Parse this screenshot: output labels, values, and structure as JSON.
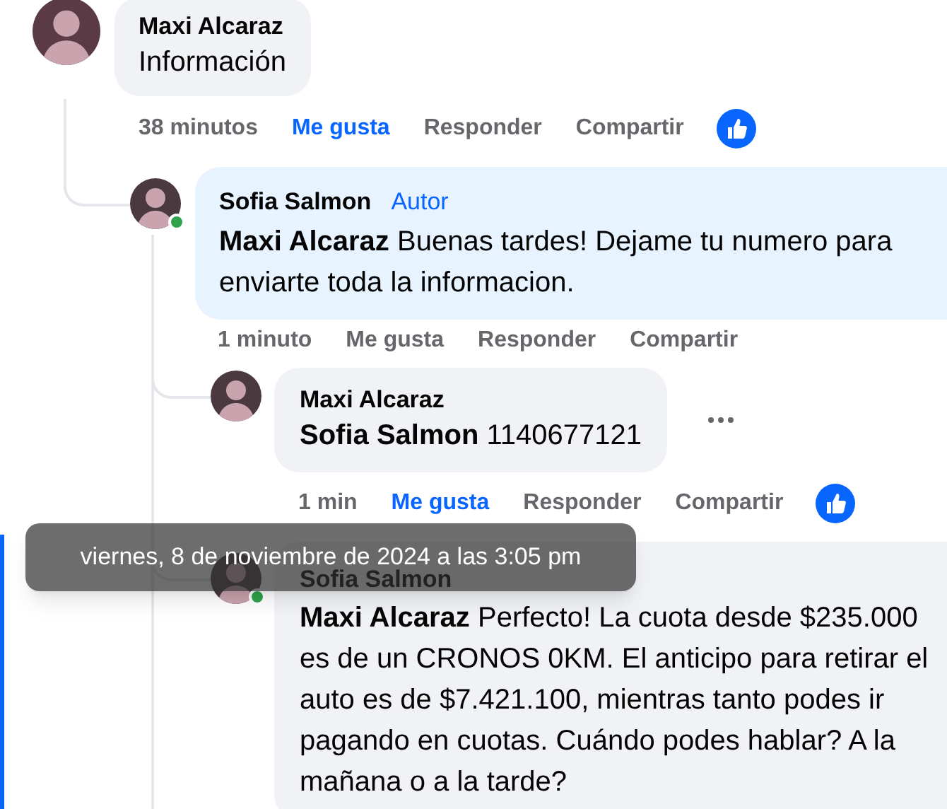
{
  "comments": [
    {
      "author": "Maxi Alcaraz",
      "text": "Información",
      "time": "38 minutos",
      "like_label": "Me gusta",
      "liked": true,
      "reply_label": "Responder",
      "share_label": "Compartir",
      "has_reactions": true,
      "online": false,
      "children": [
        {
          "author": "Sofia Salmon",
          "badge": "Autor",
          "text": "**Maxi Alcaraz** Buenas tardes! Dejame tu numero para enviarte toda la informacion.",
          "time": "1 minuto",
          "like_label": "Me gusta",
          "liked": false,
          "reply_label": "Responder",
          "share_label": "Compartir",
          "online": true,
          "children": [
            {
              "author": "Maxi Alcaraz",
              "text": "**Sofia Salmon** 1140677121",
              "time": "1 min",
              "like_label": "Me gusta",
              "liked": true,
              "reply_label": "Responder",
              "share_label": "Compartir",
              "has_reactions": true,
              "more_menu": true,
              "online": false
            },
            {
              "author": "Sofia Salmon",
              "text": "**Maxi Alcaraz** Perfecto! La cuota desde $235.000 es de un CRONOS 0KM. El anticipo para retirar el auto es de $7.421.100, mientras tanto podes ir pagando en cuotas. Cuándo podes hablar? A la mañana o a la tarde?",
              "online": true
            }
          ]
        }
      ]
    }
  ],
  "tooltip": {
    "text": "viernes, 8 de noviembre de 2024 a las 3:05 pm"
  }
}
